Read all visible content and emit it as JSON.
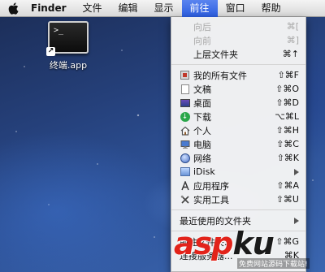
{
  "menubar": {
    "app_name": "Finder",
    "items": [
      "文件",
      "编辑",
      "显示",
      "前往",
      "窗口",
      "帮助"
    ],
    "active_item": "前往"
  },
  "desktop": {
    "icon_label": "终端.app",
    "terminal_prompt": ">_"
  },
  "go_menu": {
    "nav": [
      {
        "label": "向后",
        "shortcut": "⌘[",
        "enabled": false
      },
      {
        "label": "向前",
        "shortcut": "⌘]",
        "enabled": false
      },
      {
        "label": "上层文件夹",
        "shortcut": "⌘↑",
        "enabled": true
      }
    ],
    "places": [
      {
        "label": "我的所有文件",
        "shortcut": "⇧⌘F",
        "icon": "all-files-icon"
      },
      {
        "label": "文稿",
        "shortcut": "⇧⌘O",
        "icon": "documents-icon"
      },
      {
        "label": "桌面",
        "shortcut": "⇧⌘D",
        "icon": "desktop-icon"
      },
      {
        "label": "下载",
        "shortcut": "⌥⌘L",
        "icon": "download-icon"
      },
      {
        "label": "个人",
        "shortcut": "⇧⌘H",
        "icon": "home-icon"
      },
      {
        "label": "电脑",
        "shortcut": "⇧⌘C",
        "icon": "computer-icon"
      },
      {
        "label": "网络",
        "shortcut": "⇧⌘K",
        "icon": "network-icon"
      },
      {
        "label": "iDisk",
        "shortcut": "",
        "icon": "idisk-icon",
        "submenu": true
      },
      {
        "label": "应用程序",
        "shortcut": "⇧⌘A",
        "icon": "applications-icon"
      },
      {
        "label": "实用工具",
        "shortcut": "⇧⌘U",
        "icon": "utilities-icon"
      }
    ],
    "recent": {
      "label": "最近使用的文件夹",
      "submenu": true
    },
    "bottom": [
      {
        "label": "前往文件夹...",
        "shortcut": "⇧⌘G"
      },
      {
        "label": "连接服务器...",
        "shortcut": "⌘K"
      }
    ]
  },
  "watermark": {
    "brand_a": "asp",
    "brand_b": "ku",
    "sub": "免费网站源码下载站!"
  }
}
